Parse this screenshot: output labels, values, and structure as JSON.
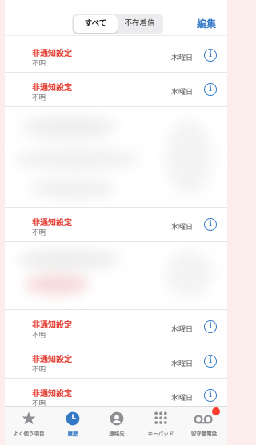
{
  "header": {
    "segment_all": "すべて",
    "segment_missed": "不在着信",
    "edit": "編集"
  },
  "calls": [
    {
      "name": "非通知設定",
      "sub": "不明",
      "day": "木曜日"
    },
    {
      "name": "非通知設定",
      "sub": "不明",
      "day": "水曜日"
    },
    {
      "name": "非通知設定",
      "sub": "不明",
      "day": "水曜日"
    },
    {
      "name": "非通知設定",
      "sub": "不明",
      "day": "水曜日"
    },
    {
      "name": "非通知設定",
      "sub": "不明",
      "day": "水曜日"
    },
    {
      "name": "非通知設定",
      "sub": "不明",
      "day": "水曜日"
    }
  ],
  "tabs": [
    {
      "label": "よく使う項目",
      "icon": "star-icon"
    },
    {
      "label": "履歴",
      "icon": "clock-icon"
    },
    {
      "label": "連絡先",
      "icon": "person-icon"
    },
    {
      "label": "キーパッド",
      "icon": "keypad-icon"
    },
    {
      "label": "留守番電話",
      "icon": "voicemail-icon"
    }
  ],
  "colors": {
    "accent": "#3478c6",
    "missed": "#e23b30",
    "badge": "#ff3b30"
  }
}
